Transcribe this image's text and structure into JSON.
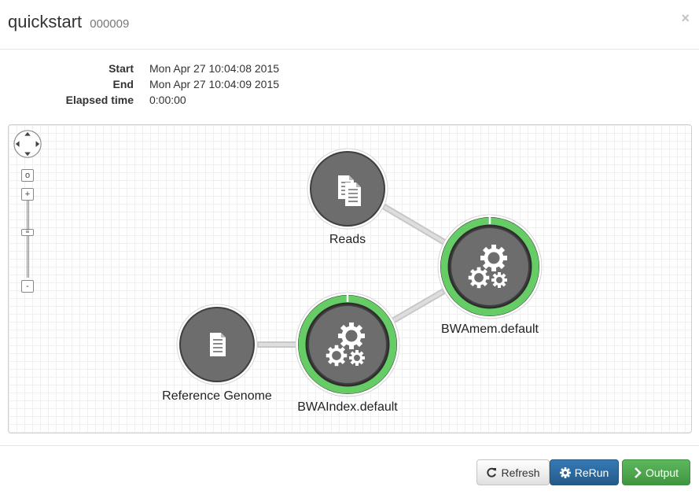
{
  "header": {
    "title": "quickstart",
    "run_id": "000009",
    "close_symbol": "×"
  },
  "info": {
    "start_label": "Start",
    "start_value": "Mon Apr 27 10:04:08 2015",
    "end_label": "End",
    "end_value": "Mon Apr 27 10:04:09 2015",
    "elapsed_label": "Elapsed time",
    "elapsed_value": "0:00:00"
  },
  "graph": {
    "zoom_reset_symbol": "o",
    "zoom_in_symbol": "+",
    "zoom_out_symbol": "-",
    "nodes": {
      "reads": {
        "label": "Reads",
        "icon": "files-icon"
      },
      "reference": {
        "label": "Reference Genome",
        "icon": "file-icon"
      },
      "bwaindex": {
        "label": "BWAIndex.default",
        "icon": "gears-icon",
        "status": "completed",
        "progress": 1.0
      },
      "bwamem": {
        "label": "BWAmem.default",
        "icon": "gears-icon",
        "status": "completed",
        "progress": 1.0
      }
    },
    "status_color": "#66cc66",
    "node_color": "#6d6d6d"
  },
  "footer": {
    "refresh_label": "Refresh",
    "rerun_label": "ReRun",
    "output_label": "Output"
  }
}
